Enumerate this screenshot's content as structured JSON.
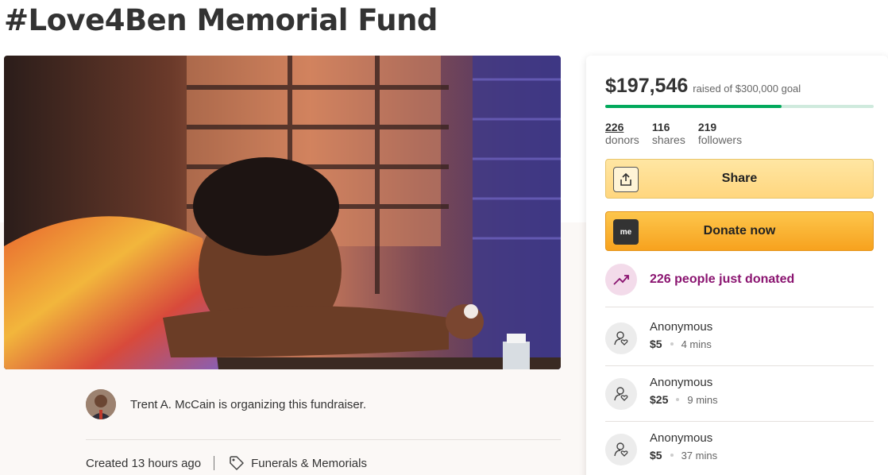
{
  "page": {
    "title": "#Love4Ben Memorial Fund"
  },
  "organizer": {
    "text": "Trent A. McCain is organizing this fundraiser.",
    "created": "Created 13 hours ago",
    "category": "Funerals & Memorials"
  },
  "campaign": {
    "raised": "$197,546",
    "goal_text": "raised of $300,000 goal",
    "progress_fraction": 0.658,
    "stats": [
      {
        "value": "226",
        "label": "donors"
      },
      {
        "value": "116",
        "label": "shares"
      },
      {
        "value": "219",
        "label": "followers"
      }
    ],
    "share_label": "Share",
    "donate_label": "Donate now",
    "donate_icon_text": "me",
    "recent_text": "226 people just donated"
  },
  "donations": [
    {
      "name": "Anonymous",
      "amount": "$5",
      "time": "4 mins"
    },
    {
      "name": "Anonymous",
      "amount": "$25",
      "time": "9 mins"
    },
    {
      "name": "Anonymous",
      "amount": "$5",
      "time": "37 mins"
    }
  ],
  "colors": {
    "progress": "#02a95c",
    "progress_track": "#cfeadd",
    "donate": "#f7a21e",
    "share": "#ffd67e",
    "trend": "#8a1470"
  },
  "icons": {
    "share": "upload-icon",
    "donate": "gofundme-logo-icon",
    "trend": "trending-up-icon",
    "donor": "donor-heart-icon",
    "category": "tag-icon"
  }
}
